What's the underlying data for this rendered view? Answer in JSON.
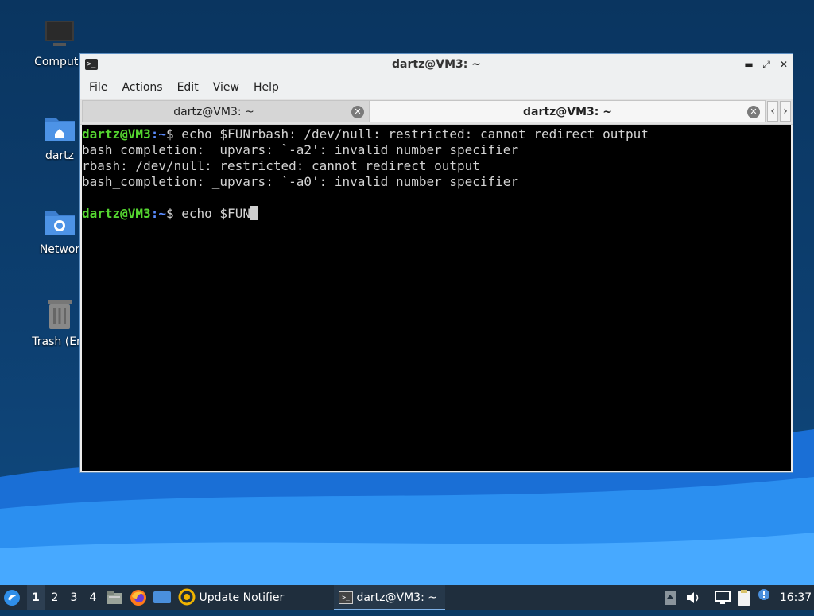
{
  "desktop": {
    "icons": [
      {
        "label": "Compute",
        "icon": "computer-icon"
      },
      {
        "label": "dartz",
        "icon": "home-folder-icon"
      },
      {
        "label": "Networ",
        "icon": "network-folder-icon"
      },
      {
        "label": "Trash (Em",
        "icon": "trash-icon"
      }
    ]
  },
  "window": {
    "title": "dartz@VM3: ~",
    "menu": [
      "File",
      "Actions",
      "Edit",
      "View",
      "Help"
    ],
    "tabs": [
      {
        "label": "dartz@VM3: ~",
        "active": false
      },
      {
        "label": "dartz@VM3: ~",
        "active": true
      }
    ]
  },
  "terminal": {
    "prompt_user": "dartz@VM3",
    "prompt_path": "~",
    "prompt_symbol": "$",
    "line1_cmd": " echo $FUNrbash: /dev/null: restricted: cannot redirect output",
    "line2": "bash_completion: _upvars: `-a2': invalid number specifier",
    "line3": "rbash: /dev/null: restricted: cannot redirect output",
    "line4": "bash_completion: _upvars: `-a0': invalid number specifier",
    "line6_cmd": " echo $FUN",
    "colors": {
      "user": "#55d630",
      "path": "#5b8cff"
    }
  },
  "taskbar": {
    "workspaces": [
      "1",
      "2",
      "3",
      "4"
    ],
    "active_workspace": "1",
    "update_notifier": "Update Notifier",
    "terminal_task": "dartz@VM3: ~",
    "clock": "16:37"
  }
}
